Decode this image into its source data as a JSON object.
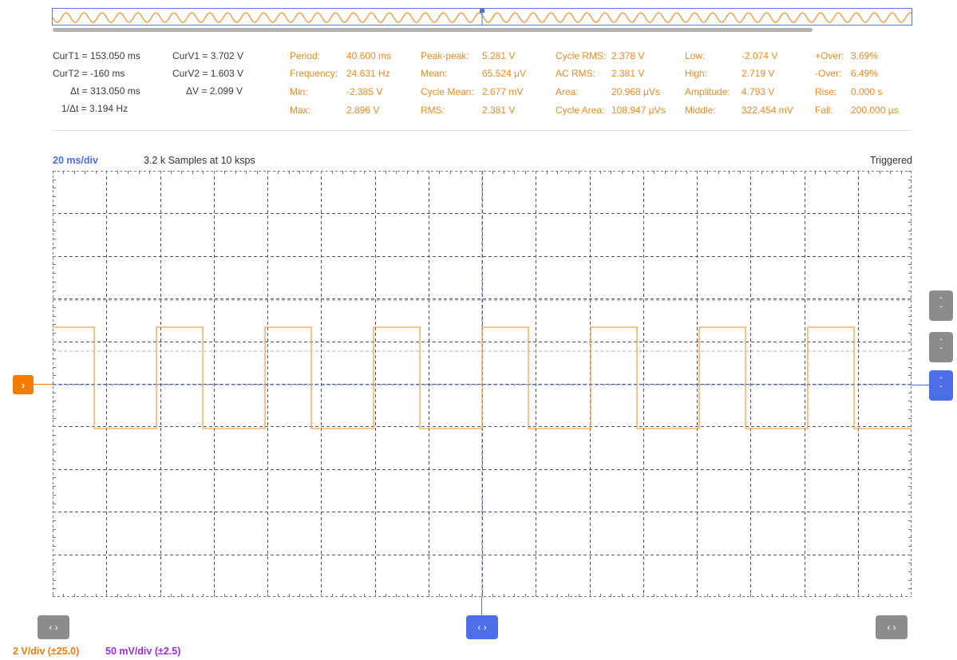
{
  "colors": {
    "channel1": "#f57c00",
    "channel2": "#9a2de0",
    "cursor": "#4c6ee6",
    "grid": "#555555",
    "button_gray": "#8c8c8c"
  },
  "cursors": {
    "curT1": "CurT1 = 153.050 ms",
    "curT2": "CurT2 = -160 ms",
    "dt": "Δt = 313.050 ms",
    "inv_dt": "1/Δt = 3.194 Hz",
    "curV1": "CurV1 = 3.702 V",
    "curV2": "CurV2 = 1.603 V",
    "dv": "ΔV =  2.099 V"
  },
  "measurements": {
    "period_label": "Period:",
    "period_value": "40.600 ms",
    "frequency_label": "Frequency:",
    "frequency_value": "24.631 Hz",
    "min_label": "Min:",
    "min_value": "-2.385 V",
    "max_label": "Max:",
    "max_value": "2.896 V",
    "peakpeak_label": "Peak-peak:",
    "peakpeak_value": "5.281 V",
    "mean_label": "Mean:",
    "mean_value": "65.524 μV",
    "cyclemean_label": "Cycle Mean:",
    "cyclemean_value": "2.677 mV",
    "rms_label": "RMS:",
    "rms_value": "2.381 V",
    "cyclerms_label": "Cycle RMS:",
    "cyclerms_value": "2.378 V",
    "acrms_label": "AC RMS:",
    "acrms_value": "2.381 V",
    "area_label": "Area:",
    "area_value": "20.968 μVs",
    "cyclearea_label": "Cycle Area:",
    "cyclearea_value": "108.947 μVs",
    "low_label": "Low:",
    "low_value": "-2.074 V",
    "high_label": "High:",
    "high_value": "2.719 V",
    "amplitude_label": "Amplitude:",
    "amplitude_value": "4.793 V",
    "middle_label": "Middle:",
    "middle_value": "322.454 mV",
    "overpos_label": "+Over:",
    "overpos_value": "3.69%",
    "overneg_label": "-Over:",
    "overneg_value": "6.49%",
    "rise_label": "Rise:",
    "rise_value": "0.000 s",
    "fall_label": "Fall:",
    "fall_value": "200.000 μs"
  },
  "scope": {
    "timebase": "20 ms/div",
    "samples_info": "3.2 k Samples at 10 ksps",
    "trigger_status": "Triggered"
  },
  "channels": {
    "ch1_scale": "2 V/div (±25.0)",
    "ch2_scale": "50 mV/div (±2.5)"
  },
  "icons": {
    "left_right": "‹ ›",
    "up_down_top": "ˆ",
    "up_down_bottom": "ˇ",
    "channel_marker": "›"
  }
}
